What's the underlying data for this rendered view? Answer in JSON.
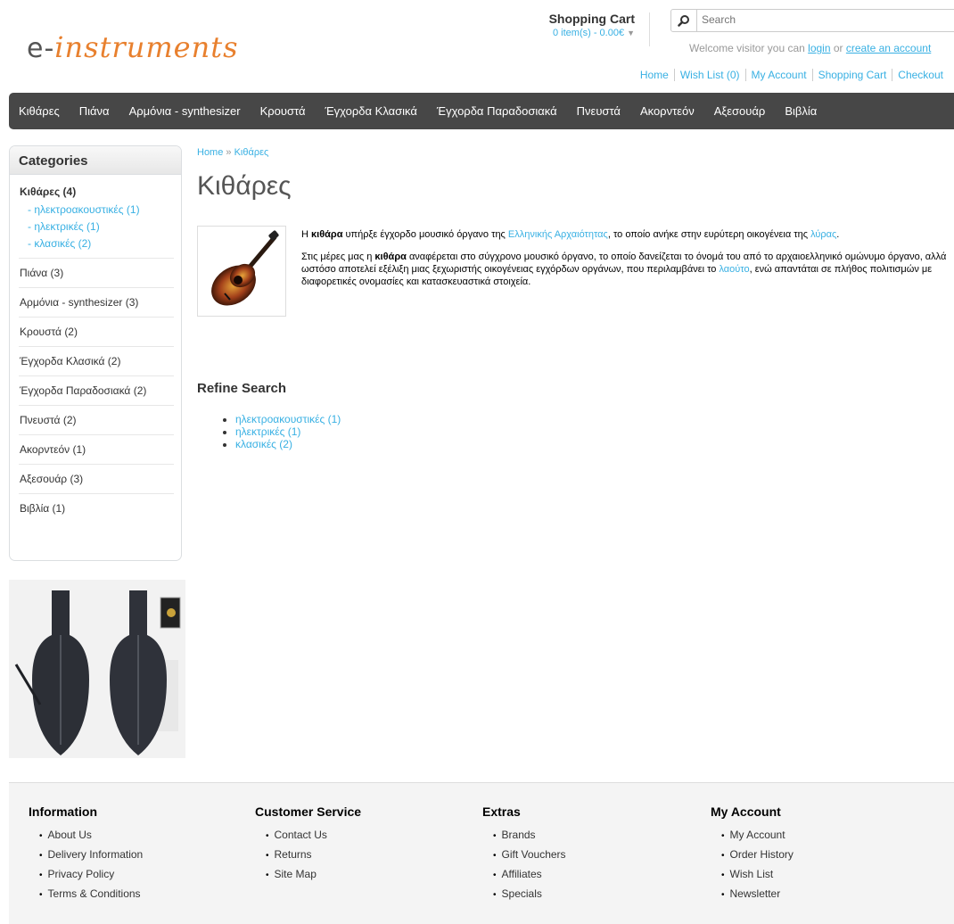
{
  "header": {
    "logo_prefix": "e-",
    "logo_text": "instruments",
    "cart_title": "Shopping Cart",
    "cart_total": "0 item(s) - 0.00€",
    "search_placeholder": "Search",
    "welcome": {
      "text": "Welcome visitor you can",
      "login": "login",
      "or": "or",
      "create": "create an account"
    },
    "top_links": [
      "Home",
      "Wish List (0)",
      "My Account",
      "Shopping Cart",
      "Checkout"
    ]
  },
  "menu": [
    "Κιθάρες",
    "Πιάνα",
    "Αρμόνια - synthesizer",
    "Κρουστά",
    "Έγχορδα Κλασικά",
    "Έγχορδα Παραδοσιακά",
    "Πνευστά",
    "Ακορντεόν",
    "Αξεσουάρ",
    "Βιβλία"
  ],
  "sidebar": {
    "heading": "Categories",
    "active": {
      "label": "Κιθάρες (4)",
      "subs": [
        "- ηλεκτροακουστικές (1)",
        "- ηλεκτρικές (1)",
        "- κλασικές (2)"
      ]
    },
    "categories": [
      "Πιάνα (3)",
      "Αρμόνια - synthesizer (3)",
      "Κρουστά (2)",
      "Έγχορδα Κλασικά (2)",
      "Έγχορδα Παραδοσιακά (2)",
      "Πνευστά (2)",
      "Ακορντεόν (1)",
      "Αξεσουάρ (3)",
      "Βιβλία (1)"
    ]
  },
  "breadcrumb": {
    "home": "Home",
    "sep": "»",
    "current": "Κιθάρες"
  },
  "page_title": "Κιθάρες",
  "description": {
    "p1": {
      "a": "Η ",
      "b": "κιθάρα",
      "c": " υπήρξε έγχορδο μουσικό όργανο της ",
      "link1": "Ελληνικής Αρχαιότητας",
      "d": ", το οποίο ανήκε στην ευρύτερη οικογένεια της ",
      "link2": "λύρας",
      "e": "."
    },
    "p2": {
      "a": "Στις μέρες μας η ",
      "b": "κιθάρα",
      "c": " αναφέρεται στο σύγχρονο μουσικό όργανο, το οποίο δανείζεται το όνομά του από το αρχαιοελληνικό ομώνυμο όργανο, αλλά ωστόσο αποτελεί εξέλιξη μιας ξεχωριστής οικογένειας εγχόρδων οργάνων, που περιλαμβάνει το ",
      "link": "λαούτο",
      "d": ", ενώ απαντάται σε πλήθος πολιτισμών με διαφορετικές ονομασίες και κατασκευαστικά στοιχεία."
    }
  },
  "refine": {
    "heading": "Refine Search",
    "items": [
      "ηλεκτροακουστικές (1)",
      "ηλεκτρικές (1)",
      "κλασικές (2)"
    ]
  },
  "footer": {
    "information": {
      "heading": "Information",
      "items": [
        "About Us",
        "Delivery Information",
        "Privacy Policy",
        "Terms & Conditions"
      ]
    },
    "customer_service": {
      "heading": "Customer Service",
      "items": [
        "Contact Us",
        "Returns",
        "Site Map"
      ]
    },
    "extras": {
      "heading": "Extras",
      "items": [
        "Brands",
        "Gift Vouchers",
        "Affiliates",
        "Specials"
      ]
    },
    "my_account": {
      "heading": "My Account",
      "items": [
        "My Account",
        "Order History",
        "Wish List",
        "Newsletter"
      ]
    }
  },
  "colors": {
    "accent": "#38B0E3",
    "logo": "#E8802E",
    "menu_bg": "#474747"
  }
}
